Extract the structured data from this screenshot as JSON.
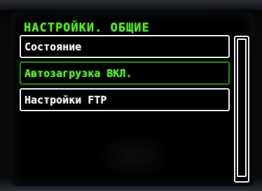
{
  "screen": {
    "title": "НАСТРОЙКИ. ОБЩИЕ"
  },
  "menu": {
    "items": [
      {
        "label": "Состояние",
        "selected": false
      },
      {
        "label": "Автозагрузка ВКЛ.",
        "selected": true
      },
      {
        "label": "Настройки FTP",
        "selected": false
      }
    ]
  },
  "scrollbar": {
    "visible_fraction": 0.98
  },
  "colors": {
    "accent": "#62e23a",
    "foreground": "#f2f4f6",
    "background": "#000000"
  }
}
